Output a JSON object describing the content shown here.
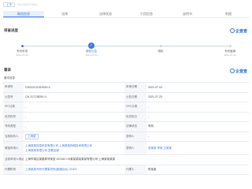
{
  "breadcrumb": {
    "tag": "上市",
    "number": "CN 2021070311"
  },
  "tabs": [
    {
      "label": "概览信息",
      "active": true
    },
    {
      "label": "法律",
      "active": false
    },
    {
      "label": "法律状态",
      "active": false
    },
    {
      "label": "引用信息",
      "active": false
    },
    {
      "label": "说明书",
      "active": false
    },
    {
      "label": "附图",
      "active": false
    }
  ],
  "sections": {
    "timeline_title": "审查进度",
    "info_title": "著录",
    "info_subtitle": "基本信息"
  },
  "brand": {
    "name": "企查查"
  },
  "timeline": [
    {
      "label": "专利申请",
      "date": "2021-07-03",
      "state": "done"
    },
    {
      "label": "授权公告",
      "date": "2021-07-23",
      "state": "current"
    },
    {
      "label": "授权",
      "date": "",
      "state": "pending"
    },
    {
      "label": "专利届满",
      "date": "2031-07-03",
      "state": "pending"
    }
  ],
  "rows": [
    {
      "l1": "申请号",
      "v1": "CN202121515315.X",
      "l2": "申请日期",
      "v2": "2021-07-03"
    },
    {
      "l1": "公告号",
      "v1": "CN 217138251 U",
      "l2": "公告日期",
      "v2": "2021-07-23"
    },
    {
      "l1": "IPC分类",
      "v1": "-",
      "l2": "CPC分类",
      "v2": "-"
    },
    {
      "l1": "优先权号",
      "v1": "-",
      "l2": "优先权日",
      "v2": "-"
    },
    {
      "l1": "专利类型",
      "v1": "-",
      "l2": "法律状态",
      "v2": "有效"
    },
    {
      "l1": "当前权利人",
      "v1": "上海某",
      "l2": "发明人",
      "v2": "-"
    },
    {
      "l1": "原始申请人",
      "v1_lines": [
        "上海某某信息科技有限公司 上海某某网络技术有限公司",
        "上海某某有限公司  查看全部"
      ],
      "l2": "发明人",
      "v2": "张某某  李某  王某某"
    },
    {
      "l1": "当前申请人地址",
      "v1": "上海市某区某路某号某室 202160 CN某某某某某某有限公司 上海某某某某",
      "l2": "",
      "v2": ""
    },
    {
      "l1": "代理机构",
      "v1": "上海某某专利代理事务所(普通合伙) 31000",
      "l2": "代理人",
      "v2": "陈某某"
    }
  ]
}
